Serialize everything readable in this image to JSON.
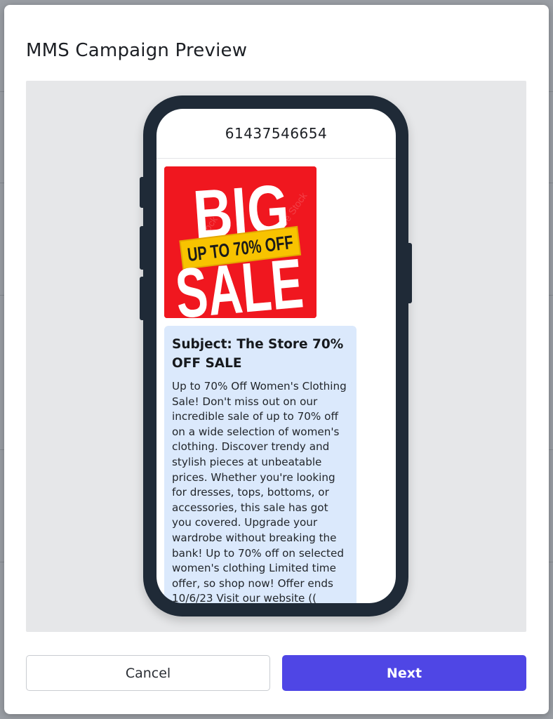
{
  "modal": {
    "title": "MMS Campaign Preview"
  },
  "phone": {
    "number": "61437546654"
  },
  "mms_image": {
    "alt": "Big Sale promotional image",
    "line1": "BIG",
    "banner": "UP TO 70% OFF",
    "line2": "SALE",
    "watermark": "Adobe Stock",
    "colors": {
      "background": "#f0171f",
      "banner": "#f8c300",
      "text": "#ffffff",
      "banner_text": "#1a1a1a"
    }
  },
  "message": {
    "subject": "Subject: The Store 70% OFF SALE",
    "body": "Up to 70% Off Women's Clothing Sale! Don't miss out on our incredible sale of up to 70% off on a wide selection of women's clothing. Discover trendy and stylish pieces at unbeatable prices. Whether you're looking for dresses, tops, bottoms, or accessories, this sale has got you covered. Upgrade your wardrobe without breaking the bank! Up to 70% off on selected women's clothing Limited time offer, so shop now! Offer ends 10/6/23 Visit our website (( Shortened URL )) or any of our"
  },
  "actions": {
    "cancel_label": "Cancel",
    "next_label": "Next"
  },
  "colors": {
    "accent": "#4f46e5",
    "bubble": "#dbe9fc",
    "phone_frame": "#1f2a37"
  }
}
